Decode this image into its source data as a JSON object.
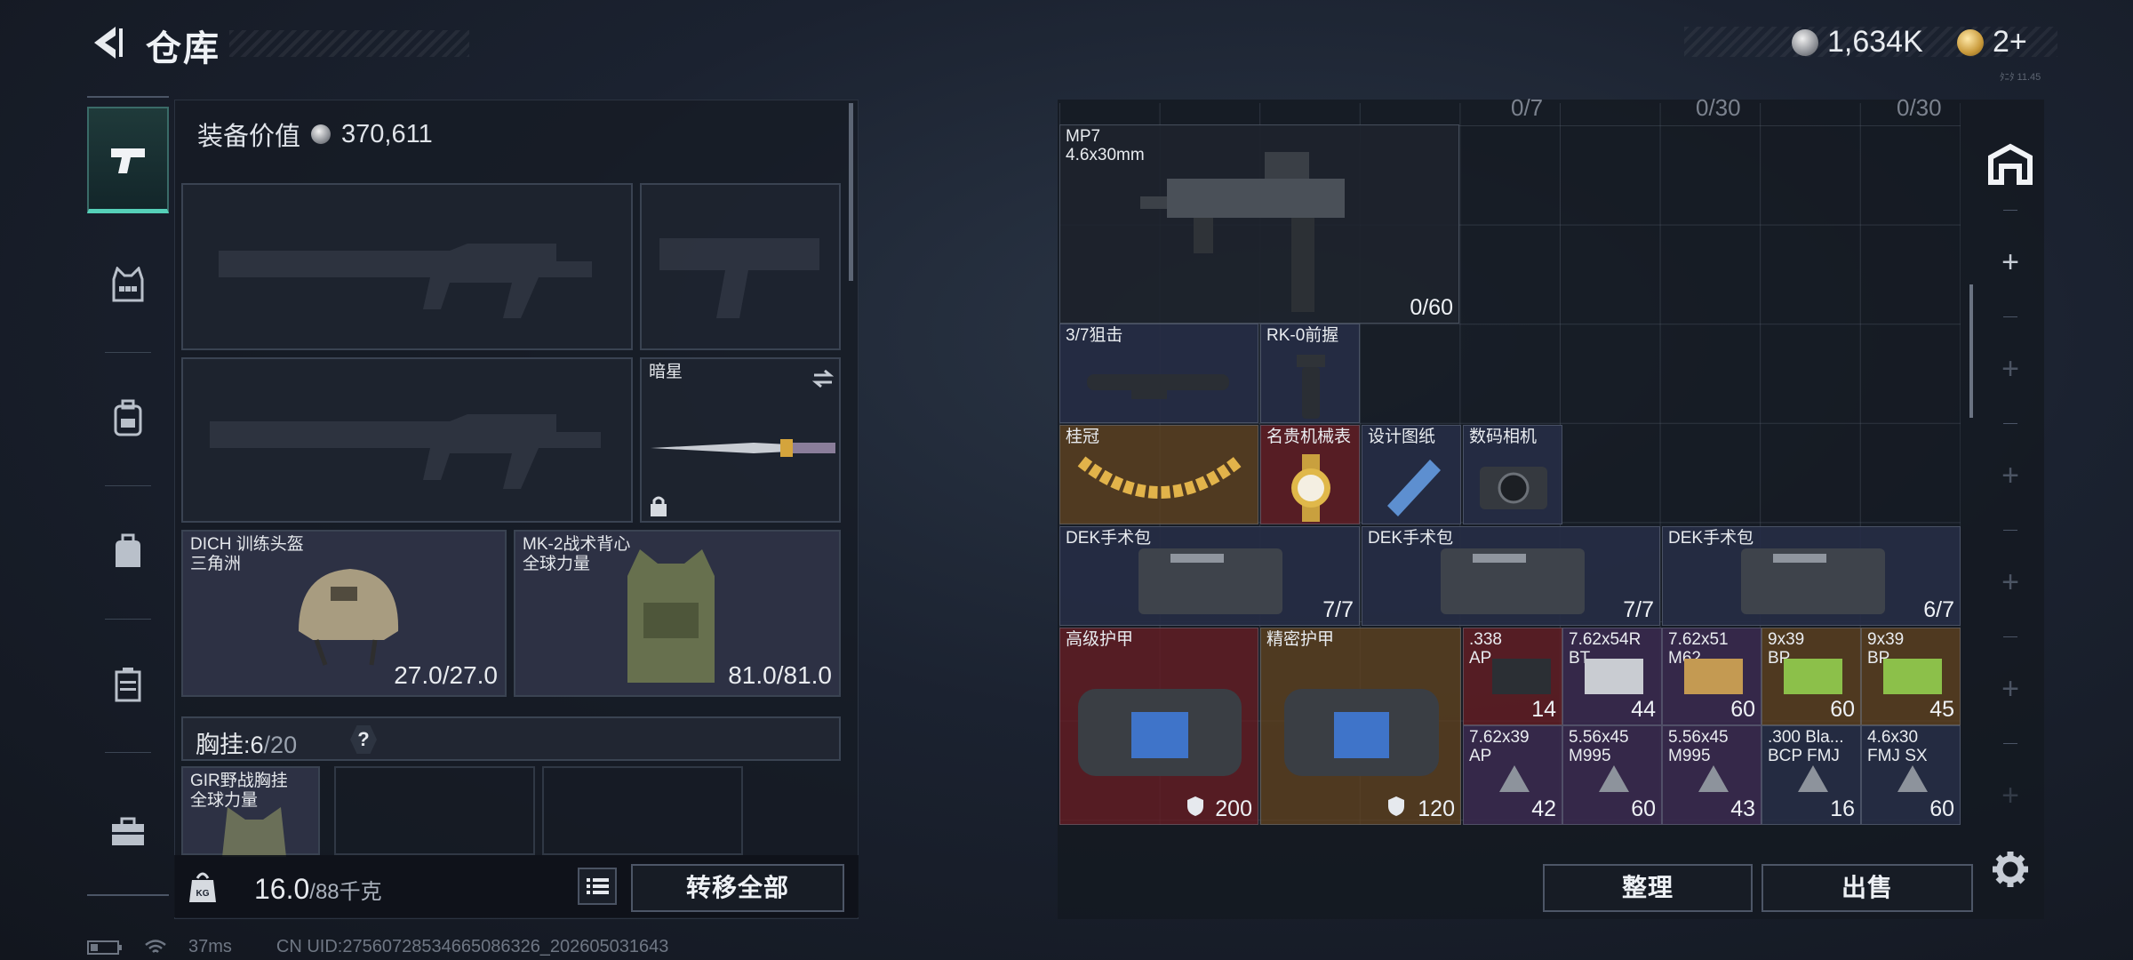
{
  "header": {
    "title": "仓库",
    "silver": "1,634K",
    "gold": "2+",
    "server_tag": "ﾀﾆﾀ 11.45"
  },
  "equipment": {
    "value_label": "装备价值",
    "value": "370,611",
    "melee_name": "暗星",
    "helmet": {
      "name": "DICH 训练头盔\n三角洲",
      "durability": "27.0/27.0"
    },
    "armor": {
      "name": "MK-2战术背心\n全球力量",
      "durability": "81.0/81.0"
    },
    "chest_rig_label": "胸挂:",
    "chest_rig_count": "6",
    "chest_rig_total": "/20",
    "chest_rig_help": "?",
    "rig_item": {
      "name": "GIR野战胸挂\n全球力量"
    },
    "weight": "16.0",
    "weight_max": "/88千克",
    "transfer_all": "转移全部"
  },
  "inventory": {
    "capacity_labels": [
      "0/7",
      "0/30",
      "0/30"
    ],
    "items": [
      {
        "name": "MP7\n4.6x30mm",
        "count": "0/60"
      },
      {
        "name": "3/7狙击",
        "count": ""
      },
      {
        "name": "RK-0前握",
        "count": ""
      },
      {
        "name": "桂冠",
        "count": ""
      },
      {
        "name": "名贵机械表",
        "count": ""
      },
      {
        "name": "设计图纸",
        "count": ""
      },
      {
        "name": "数码相机",
        "count": ""
      },
      {
        "name": "DEK手术包",
        "count": "7/7"
      },
      {
        "name": "DEK手术包",
        "count": "7/7"
      },
      {
        "name": "DEK手术包",
        "count": "6/7"
      },
      {
        "name": "高级护甲",
        "count": "200"
      },
      {
        "name": "精密护甲",
        "count": "120"
      },
      {
        "name": ".338\nAP",
        "count": "14"
      },
      {
        "name": "7.62x54R\nBT",
        "count": "44"
      },
      {
        "name": "7.62x51\nM62",
        "count": "60"
      },
      {
        "name": "9x39\nBP",
        "count": "60"
      },
      {
        "name": "9x39\nBP",
        "count": "45"
      },
      {
        "name": "7.62x39\nAP",
        "count": "42"
      },
      {
        "name": "5.56x45\nM995",
        "count": "60"
      },
      {
        "name": "5.56x45\nM995",
        "count": "43"
      },
      {
        "name": ".300 Bla...\nBCP FMJ",
        "count": "16"
      },
      {
        "name": "4.6x30\nFMJ SX",
        "count": "60"
      }
    ],
    "sort_label": "整理",
    "sell_label": "出售"
  },
  "rightbar": {
    "plus": "+"
  },
  "status": {
    "ping": "37ms",
    "uid": "CN UID:2756072853466508­6326_202605031643"
  },
  "colors": {
    "accent": "#55d0b8",
    "gold_item": "#604220",
    "red_item": "#681e24",
    "blue_item": "#262c44"
  }
}
